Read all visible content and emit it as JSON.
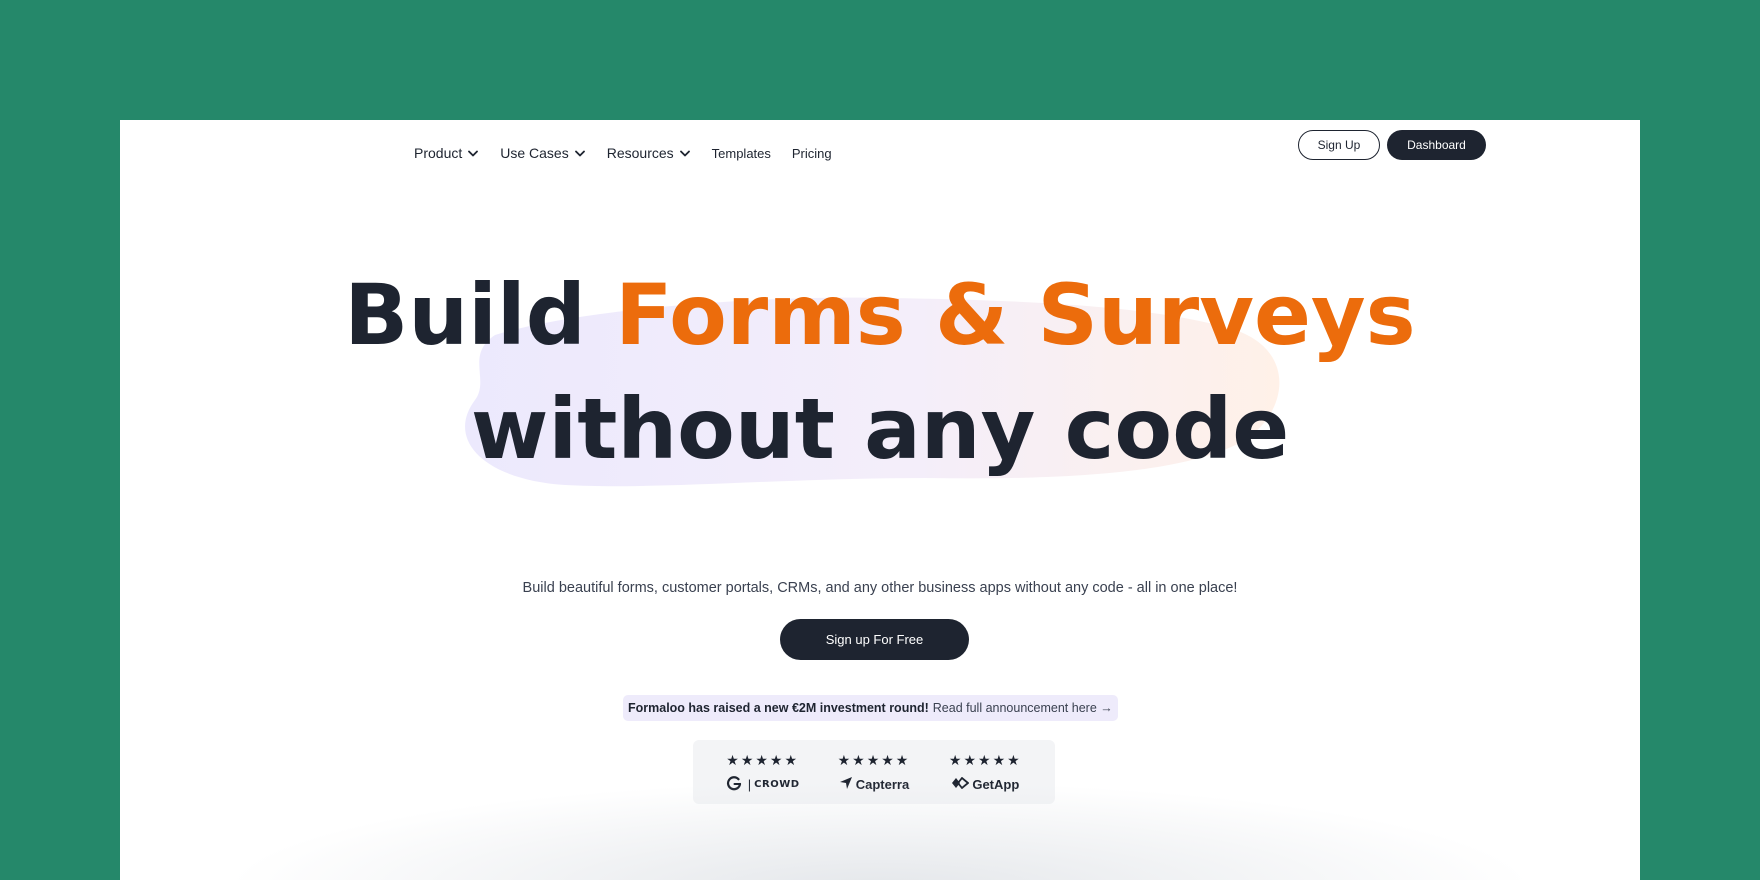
{
  "nav": {
    "items": [
      {
        "label": "Product",
        "has_dropdown": true,
        "icon": "chevron-down-icon"
      },
      {
        "label": "Use Cases",
        "has_dropdown": true,
        "icon": "chevron-down-icon"
      },
      {
        "label": "Resources",
        "has_dropdown": true,
        "icon": "chevron-down-icon"
      },
      {
        "label": "Templates",
        "has_dropdown": false
      },
      {
        "label": "Pricing",
        "has_dropdown": false
      }
    ],
    "sign_up_label": "Sign Up",
    "dashboard_label": "Dashboard"
  },
  "hero": {
    "title_part1": "Build ",
    "title_accent": "Forms & Surveys",
    "title_line2": "without any code",
    "subtitle": "Build beautiful forms, customer portals, CRMs, and any other business apps without any code - all in one place!",
    "cta_label": "Sign up For Free"
  },
  "announcement": {
    "bold": "Formaloo has raised a new €2M investment round!",
    "link": "Read full announcement here →"
  },
  "ratings": [
    {
      "stars": "★★★★★",
      "brand": "CROWD",
      "icon": "g2-logo-icon"
    },
    {
      "stars": "★★★★★",
      "brand": "Capterra",
      "icon": "capterra-logo-icon"
    },
    {
      "stars": "★★★★★",
      "brand": "GetApp",
      "icon": "getapp-logo-icon"
    }
  ],
  "colors": {
    "background": "#25886a",
    "text_dark": "#1e2430",
    "accent_orange": "#ec6c0c",
    "announcement_bg": "#eeebfb"
  }
}
